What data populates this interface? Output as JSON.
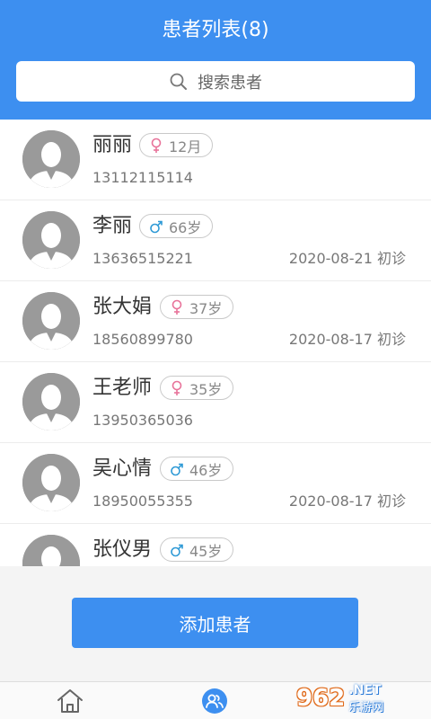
{
  "header": {
    "title": "患者列表(8)",
    "search_placeholder": "搜索患者",
    "color": "#3d8ff0"
  },
  "patients": [
    {
      "name": "丽丽",
      "gender": "female",
      "age": "12月",
      "phone": "13112115114",
      "visit": ""
    },
    {
      "name": "李丽",
      "gender": "male",
      "age": "66岁",
      "phone": "13636515221",
      "visit": "2020-08-21 初诊"
    },
    {
      "name": "张大娟",
      "gender": "female",
      "age": "37岁",
      "phone": "18560899780",
      "visit": "2020-08-17 初诊"
    },
    {
      "name": "王老师",
      "gender": "female",
      "age": "35岁",
      "phone": "13950365036",
      "visit": ""
    },
    {
      "name": "吴心情",
      "gender": "male",
      "age": "46岁",
      "phone": "18950055355",
      "visit": "2020-08-17 初诊"
    },
    {
      "name": "张仪男",
      "gender": "male",
      "age": "45岁",
      "phone": "",
      "visit": ""
    }
  ],
  "add_button": {
    "label": "添加患者"
  },
  "tabbar": {
    "items": [
      {
        "icon": "home-icon",
        "active": false
      },
      {
        "icon": "patients-icon",
        "active": true
      }
    ]
  },
  "watermark": {
    "logo": "962",
    "net": ".NET",
    "text": "乐游网"
  },
  "colors": {
    "female": "#e8739a",
    "male": "#2f9ad6",
    "accent": "#3d8ff0"
  }
}
